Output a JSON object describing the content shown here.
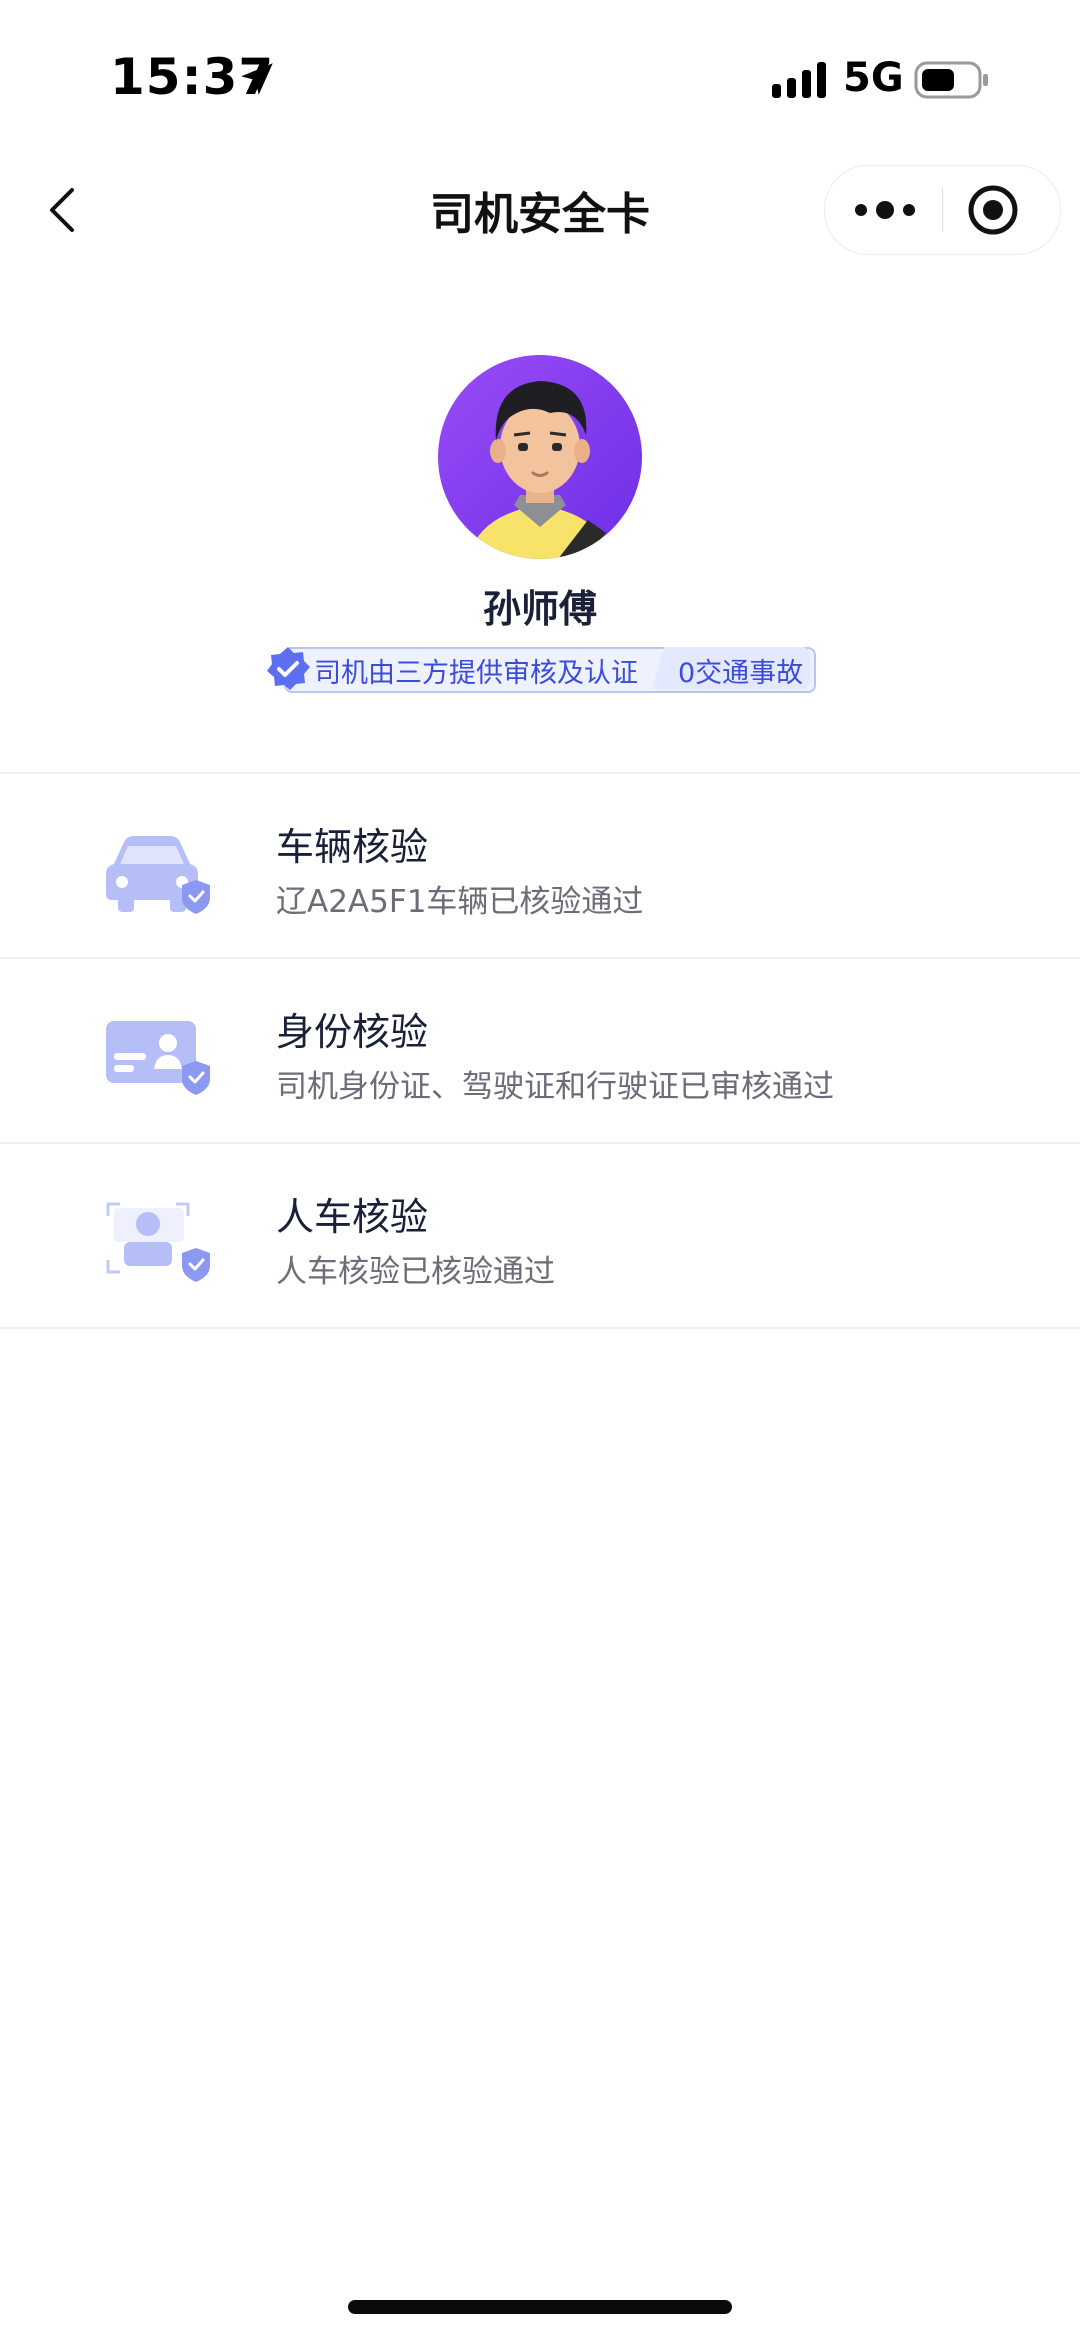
{
  "status_bar": {
    "time": "15:37",
    "network": "5G",
    "icons": [
      "location-arrow-icon",
      "signal-icon",
      "battery-icon"
    ]
  },
  "nav": {
    "title": "司机安全卡",
    "icons": [
      "back-chevron-icon",
      "more-dots-icon",
      "close-target-icon"
    ]
  },
  "driver": {
    "name": "孙师傅",
    "badge_text": "司机由三方提供审核及认证",
    "accident_text": "0交通事故"
  },
  "checks": [
    {
      "icon": "car-shield-icon",
      "title": "车辆核验",
      "desc": "辽A2A5F1车辆已核验通过"
    },
    {
      "icon": "id-card-shield-icon",
      "title": "身份核验",
      "desc": "司机身份证、驾驶证和行驶证已审核通过"
    },
    {
      "icon": "person-scan-shield-icon",
      "title": "人车核验",
      "desc": "人车核验已核验通过"
    }
  ],
  "colors": {
    "accent": "#3a4cd8",
    "icon_tint": "#a9b3f5",
    "avatar_bg": "#8b3df0"
  }
}
